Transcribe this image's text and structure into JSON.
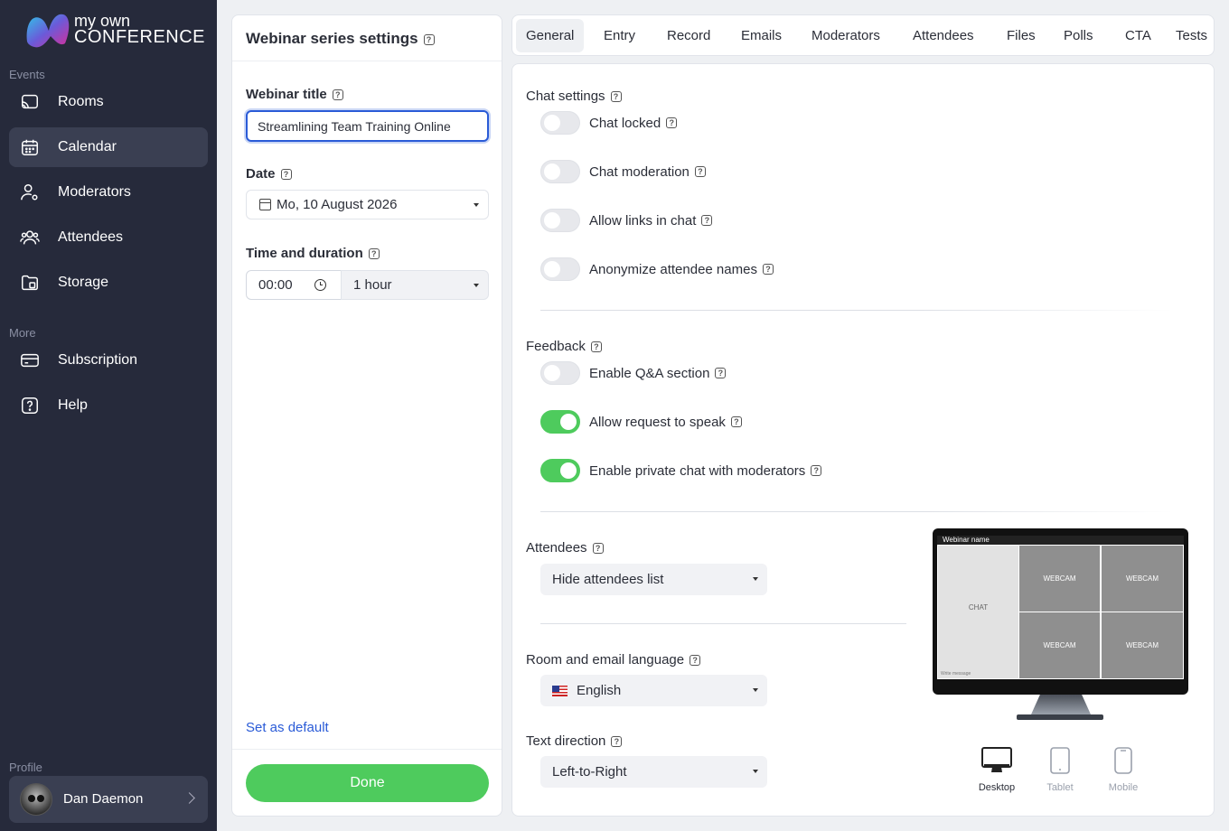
{
  "brand": {
    "line1": "my own",
    "line2": "CONFERENCE"
  },
  "sidebar": {
    "section_events": "Events",
    "section_more": "More",
    "section_profile": "Profile",
    "items": [
      {
        "label": "Rooms",
        "icon": "cast-icon"
      },
      {
        "label": "Calendar",
        "icon": "calendar-icon",
        "active": true
      },
      {
        "label": "Moderators",
        "icon": "user-gear-icon"
      },
      {
        "label": "Attendees",
        "icon": "users-icon"
      },
      {
        "label": "Storage",
        "icon": "folder-icon"
      },
      {
        "label": "Subscription",
        "icon": "credit-card-icon"
      },
      {
        "label": "Help",
        "icon": "question-icon"
      }
    ],
    "profile_name": "Dan Daemon"
  },
  "settings": {
    "title": "Webinar series settings",
    "webinar_title_label": "Webinar title",
    "webinar_title_value": "Streamlining Team Training Online",
    "date_label": "Date",
    "date_value": "Mo, 10 August 2026",
    "time_label": "Time and duration",
    "time_value": "00:00",
    "duration_value": "1 hour",
    "set_default": "Set as default",
    "done": "Done"
  },
  "tabs": [
    "General",
    "Entry",
    "Record",
    "Emails",
    "Moderators",
    "Attendees",
    "Files",
    "Polls",
    "CTA",
    "Tests"
  ],
  "general": {
    "chat_title": "Chat settings",
    "chat_toggles": [
      {
        "label": "Chat locked",
        "on": false
      },
      {
        "label": "Chat moderation",
        "on": false
      },
      {
        "label": "Allow links in chat",
        "on": false
      },
      {
        "label": "Anonymize attendee names",
        "on": false
      }
    ],
    "feedback_title": "Feedback",
    "feedback_toggles": [
      {
        "label": "Enable Q&A section",
        "on": false
      },
      {
        "label": "Allow request to speak",
        "on": true
      },
      {
        "label": "Enable private chat with moderators",
        "on": true
      }
    ],
    "attendees_title": "Attendees",
    "attendees_value": "Hide attendees list",
    "language_title": "Room and email language",
    "language_value": "English",
    "direction_title": "Text direction",
    "direction_value": "Left-to-Right"
  },
  "preview": {
    "webinar_name": "Webinar name",
    "chat": "CHAT",
    "chat_input": "Write message",
    "webcam": "WEBCAM",
    "devices": [
      "Desktop",
      "Tablet",
      "Mobile"
    ]
  },
  "colors": {
    "sidebar_bg": "#262a3b",
    "accent_green": "#4ecb5d",
    "link_blue": "#2a5bd7"
  }
}
